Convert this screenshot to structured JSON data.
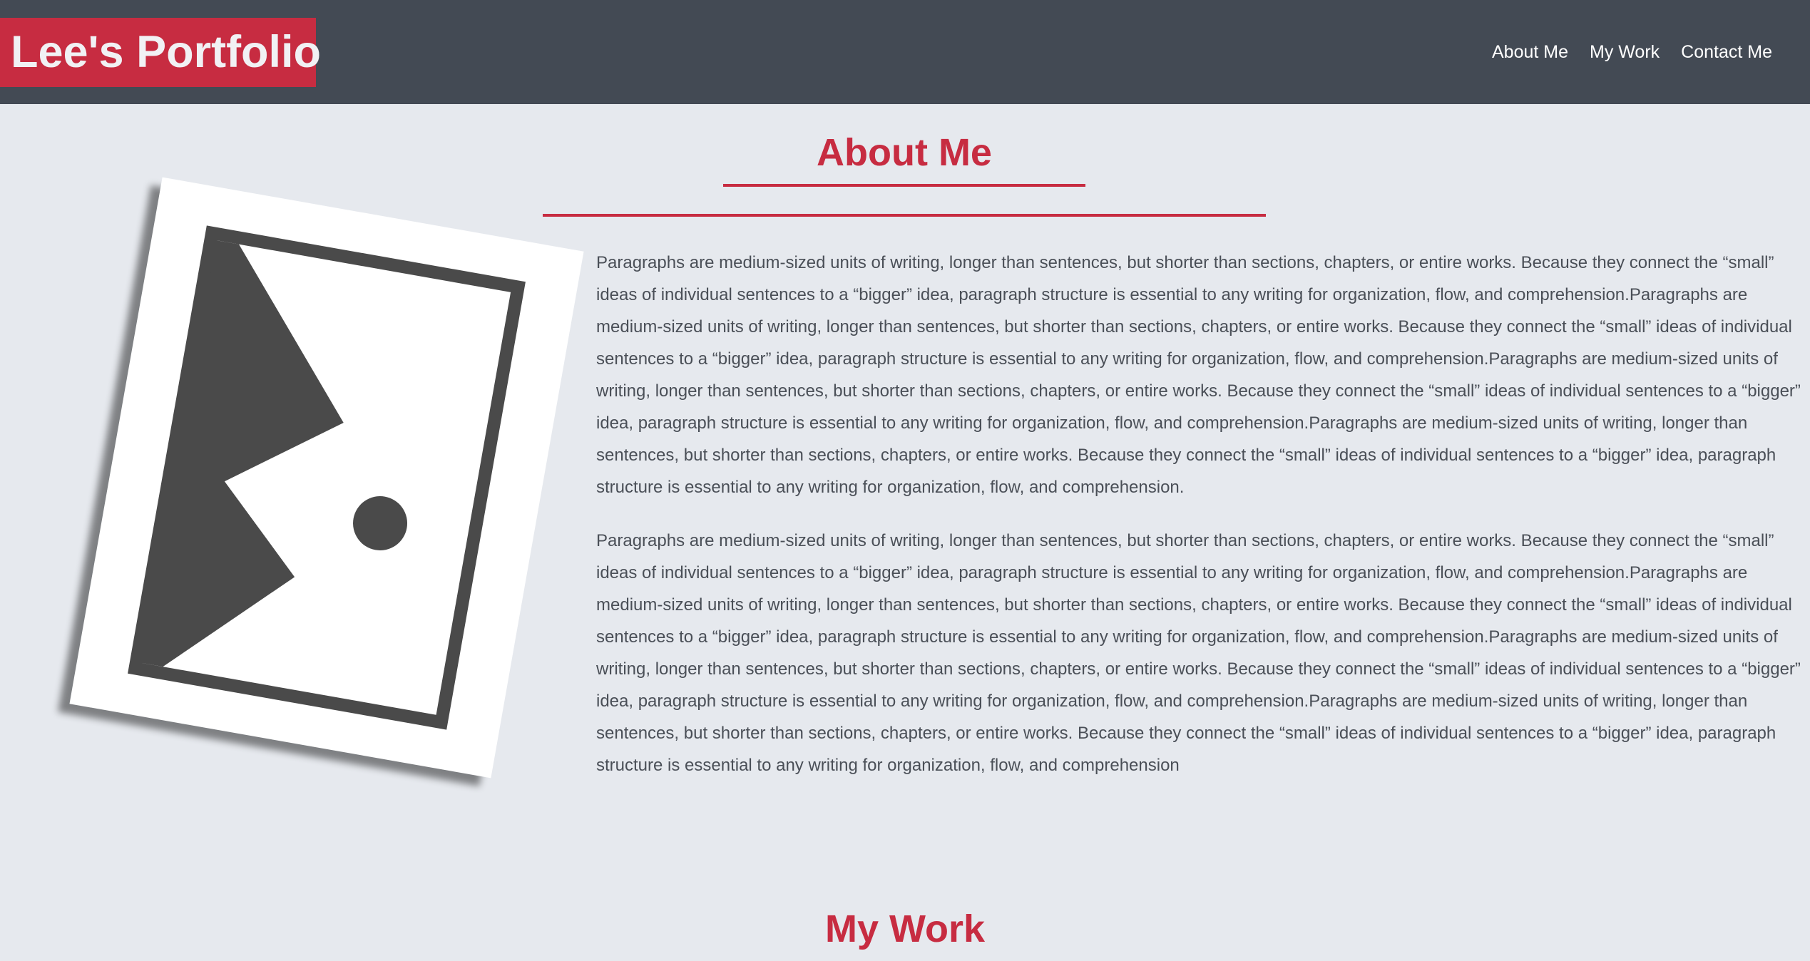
{
  "header": {
    "brand": "Lee's Portfolio",
    "nav": [
      {
        "label": "About Me"
      },
      {
        "label": "My Work"
      },
      {
        "label": "Contact Me"
      }
    ]
  },
  "about": {
    "title": "About Me",
    "paragraphs": [
      "Paragraphs are medium-sized units of writing, longer than sentences, but shorter than sections, chapters, or entire works. Because they connect the “small” ideas of individual sentences to a “bigger” idea, paragraph structure is essential to any writing for organization, flow, and comprehension.Paragraphs are medium-sized units of writing, longer than sentences, but shorter than sections, chapters, or entire works. Because they connect the “small” ideas of individual sentences to a “bigger” idea, paragraph structure is essential to any writing for organization, flow, and comprehension.Paragraphs are medium-sized units of writing, longer than sentences, but shorter than sections, chapters, or entire works. Because they connect the “small” ideas of individual sentences to a “bigger” idea, paragraph structure is essential to any writing for organization, flow, and comprehension.Paragraphs are medium-sized units of writing, longer than sentences, but shorter than sections, chapters, or entire works. Because they connect the “small” ideas of individual sentences to a “bigger” idea, paragraph structure is essential to any writing for organization, flow, and comprehension.",
      "Paragraphs are medium-sized units of writing, longer than sentences, but shorter than sections, chapters, or entire works. Because they connect the “small” ideas of individual sentences to a “bigger” idea, paragraph structure is essential to any writing for organization, flow, and comprehension.Paragraphs are medium-sized units of writing, longer than sentences, but shorter than sections, chapters, or entire works. Because they connect the “small” ideas of individual sentences to a “bigger” idea, paragraph structure is essential to any writing for organization, flow, and comprehension.Paragraphs are medium-sized units of writing, longer than sentences, but shorter than sections, chapters, or entire works. Because they connect the “small” ideas of individual sentences to a “bigger” idea, paragraph structure is essential to any writing for organization, flow, and comprehension.Paragraphs are medium-sized units of writing, longer than sentences, but shorter than sections, chapters, or entire works. Because they connect the “small” ideas of individual sentences to a “bigger” idea, paragraph structure is essential to any writing for organization, flow, and comprehension"
    ],
    "photo_icon": "image-placeholder-icon"
  },
  "work": {
    "title": "My Work"
  },
  "colors": {
    "header_bg": "#434a54",
    "accent": "#c72c41",
    "page_bg": "#e6e9ee",
    "text": "#4a4f57"
  }
}
